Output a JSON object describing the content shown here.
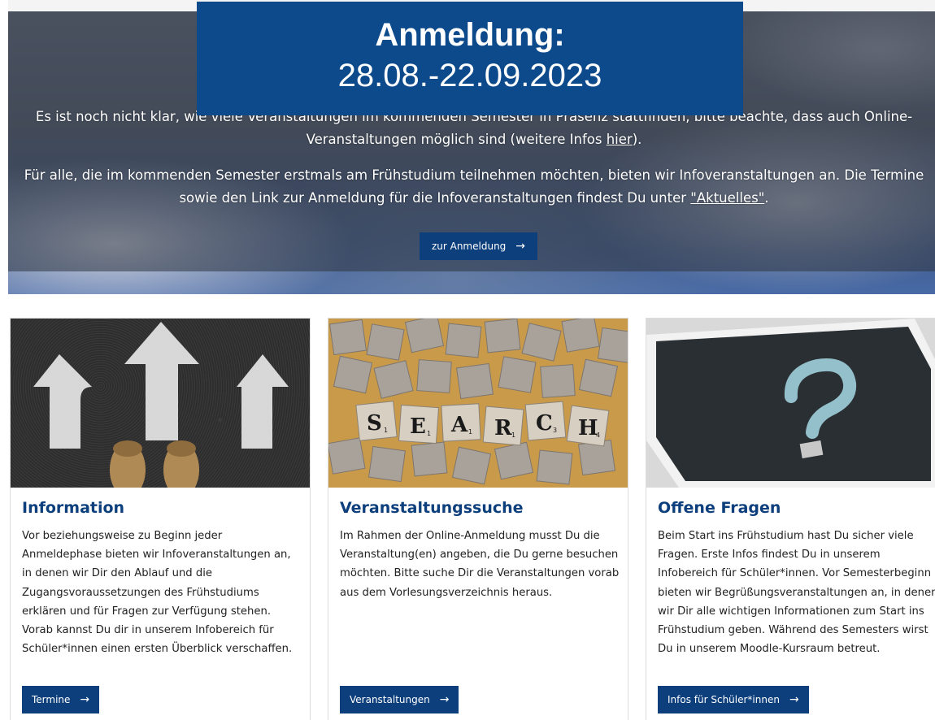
{
  "announcement": {
    "title": "Anmeldung:",
    "dates": "28.08.-22.09.2023"
  },
  "hero": {
    "paragraph1_text": "Es ist noch nicht klar, wie viele Veranstaltungen im kommenden Semester in Präsenz stattfinden, bitte beachte, dass auch Online-Veranstaltungen möglich sind (weitere Infos ",
    "paragraph1_link": "hier",
    "paragraph1_end": ").",
    "paragraph2_text": "Für alle, die im kommenden Semester erstmals am Frühstudium teilnehmen möchten, bieten wir Infoveranstaltungen an. Die Termine sowie den Link zur Anmeldung für die Infoveranstaltungen findest Du unter ",
    "paragraph2_link": "\"Aktuelles\"",
    "paragraph2_end": ".",
    "button_label": "zur Anmeldung"
  },
  "cards": [
    {
      "title": "Information",
      "body": "Vor beziehungsweise zu Beginn jeder Anmeldephase bieten wir Infoveranstaltungen an, in denen wir Dir den Ablauf und die Zugangsvoraussetzungen des Frühstudiums erklären und für Fragen zur Verfügung stehen. Vorab kannst Du dir in unserem Infobereich für Schüler*innen einen ersten Überblick verschaffen.",
      "button_label": "Termine"
    },
    {
      "title": "Veranstaltungssuche",
      "body": "Im Rahmen der Online-Anmeldung musst Du die Veranstaltung(en) angeben, die Du gerne besuchen möchten. Bitte suche Dir die Veranstaltungen vorab aus dem Vorlesungsverzeichnis heraus.",
      "button_label": "Veranstaltungen",
      "image_letters": [
        "S",
        "E",
        "A",
        "R",
        "C",
        "H"
      ],
      "image_letter_scores": [
        "1",
        "1",
        "1",
        "1",
        "3",
        "4"
      ]
    },
    {
      "title": "Offene Fragen",
      "body": "Beim Start ins Frühstudium hast Du sicher viele Fragen. Erste Infos findest Du in unserem Infobereich für Schüler*innen. Vor Semesterbeginn bieten wir Begrüßungsveranstaltungen an, in denen wir Dir alle wichtigen Informationen zum Start ins Frühstudium geben. Während des Semesters wirst Du in unserem Moodle-Kursraum betreut.",
      "button_label": "Infos für Schüler*innen"
    }
  ],
  "icons": {
    "button_arrow": "arrow-right-icon"
  },
  "colors": {
    "brand_blue": "#0d4a8b",
    "button_blue": "#0d3f7d",
    "title_blue": "#0d3f7d"
  }
}
